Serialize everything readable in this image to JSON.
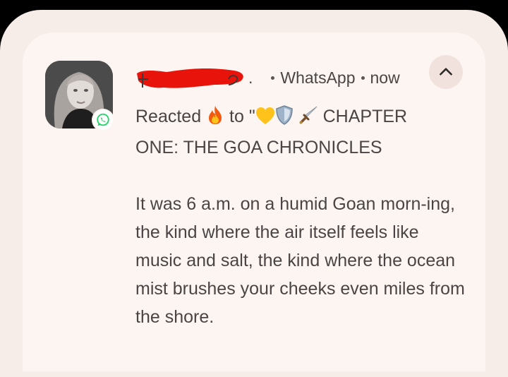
{
  "notification": {
    "app_name": "WhatsApp",
    "time": "now",
    "sender_suffix": ".",
    "reaction_prefix": "Reacted",
    "reaction_to": "to \"",
    "chapter_title_line1": "CHAPTER",
    "chapter_title_line2": "ONE: THE GOA CHRONICLES",
    "paragraph": "It was 6 a.m. on a humid Goan morn-ing, the kind where the air itself feels like music and salt, the kind where the ocean mist brushes your cheeks even miles from the shore.",
    "icons": {
      "reaction": "fire-emoji",
      "quoted": [
        "yellow-heart-emoji",
        "shield-emoji",
        "dagger-emoji"
      ],
      "badge": "whatsapp-icon",
      "expand": "chevron-up-icon"
    }
  },
  "colors": {
    "background": "#000000",
    "card": "#fcf5f2",
    "text": "#4a4544",
    "whatsapp_green": "#25D366",
    "redaction": "#e8140c"
  }
}
